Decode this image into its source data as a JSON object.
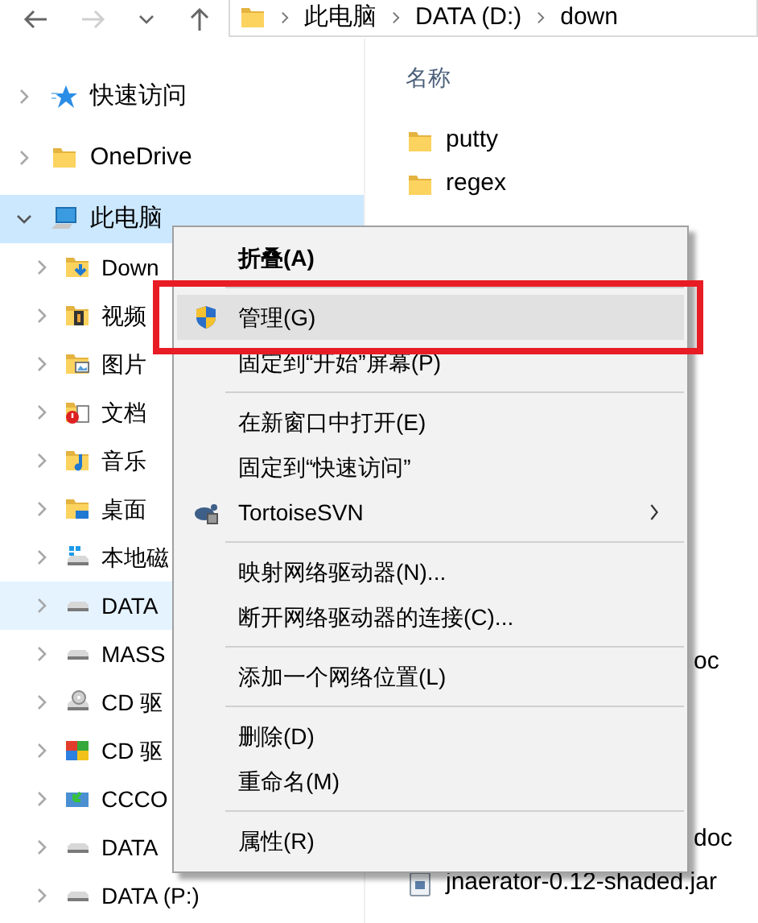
{
  "breadcrumb": [
    "此电脑",
    "DATA (D:)",
    "down"
  ],
  "column_header": "名称",
  "tree": [
    {
      "label": "快速访问",
      "kind": "star",
      "expanded": false,
      "selected": false,
      "hovered": false
    },
    {
      "label": "OneDrive",
      "kind": "folder",
      "expanded": false,
      "selected": false,
      "hovered": false
    },
    {
      "label": "此电脑",
      "kind": "pc",
      "expanded": true,
      "selected": true,
      "hovered": false,
      "children": [
        {
          "label": "Down",
          "kind": "downloads",
          "expanded": false,
          "selected": false,
          "hovered": false
        },
        {
          "label": "视频",
          "kind": "videos",
          "expanded": false,
          "selected": false,
          "hovered": false
        },
        {
          "label": "图片",
          "kind": "pictures",
          "expanded": false,
          "selected": false,
          "hovered": false
        },
        {
          "label": "文档",
          "kind": "documents",
          "expanded": false,
          "selected": false,
          "hovered": false
        },
        {
          "label": "音乐",
          "kind": "music",
          "expanded": false,
          "selected": false,
          "hovered": false
        },
        {
          "label": "桌面",
          "kind": "desktop",
          "expanded": false,
          "selected": false,
          "hovered": false
        },
        {
          "label": "本地磁",
          "kind": "system_drive",
          "expanded": false,
          "selected": false,
          "hovered": false
        },
        {
          "label": "DATA",
          "kind": "drive",
          "expanded": false,
          "selected": false,
          "hovered": true
        },
        {
          "label": "MASS",
          "kind": "drive",
          "expanded": false,
          "selected": false,
          "hovered": false
        },
        {
          "label": "CD 驱",
          "kind": "cd",
          "expanded": false,
          "selected": false,
          "hovered": false
        },
        {
          "label": "CD 驱",
          "kind": "cd_windows",
          "expanded": false,
          "selected": false,
          "hovered": false
        },
        {
          "label": "CCCO",
          "kind": "network_drive",
          "expanded": false,
          "selected": false,
          "hovered": false
        },
        {
          "label": "DATA",
          "kind": "drive",
          "expanded": false,
          "selected": false,
          "hovered": false
        },
        {
          "label": "DATA (P:)",
          "kind": "drive",
          "expanded": false,
          "selected": false,
          "hovered": false
        }
      ]
    }
  ],
  "files_above_menu": [
    {
      "name": "putty",
      "kind": "folder"
    },
    {
      "name": "regex",
      "kind": "folder"
    }
  ],
  "files_beside_menu": [
    {
      "name": "oc"
    }
  ],
  "files_below_menu": [
    {
      "name": "doc"
    },
    {
      "name": "jnaerator-0.12-shaded.jar",
      "kind": "jar"
    }
  ],
  "context_menu": {
    "items": [
      {
        "kind": "item",
        "label": "折叠(A)",
        "bold": true,
        "highlighted": false
      },
      {
        "kind": "separator"
      },
      {
        "kind": "shield_item",
        "label": "管理(G)",
        "bold": false,
        "highlighted": true
      },
      {
        "kind": "item",
        "label": "固定到“开始”屏幕(P)",
        "bold": false,
        "highlighted": false
      },
      {
        "kind": "separator"
      },
      {
        "kind": "item",
        "label": "在新窗口中打开(E)",
        "bold": false,
        "highlighted": false
      },
      {
        "kind": "item",
        "label": "固定到“快速访问”",
        "bold": false,
        "highlighted": false
      },
      {
        "kind": "turtle_item",
        "label": "TortoiseSVN",
        "bold": false,
        "highlighted": false,
        "submenu": true
      },
      {
        "kind": "separator"
      },
      {
        "kind": "item",
        "label": "映射网络驱动器(N)...",
        "bold": false,
        "highlighted": false
      },
      {
        "kind": "item",
        "label": "断开网络驱动器的连接(C)...",
        "bold": false,
        "highlighted": false
      },
      {
        "kind": "separator"
      },
      {
        "kind": "item",
        "label": "添加一个网络位置(L)",
        "bold": false,
        "highlighted": false
      },
      {
        "kind": "separator"
      },
      {
        "kind": "item",
        "label": "删除(D)",
        "bold": false,
        "highlighted": false
      },
      {
        "kind": "item",
        "label": "重命名(M)",
        "bold": false,
        "highlighted": false
      },
      {
        "kind": "separator"
      },
      {
        "kind": "item",
        "label": "属性(R)",
        "bold": false,
        "highlighted": false
      }
    ]
  },
  "annotation": {
    "kind": "box"
  }
}
